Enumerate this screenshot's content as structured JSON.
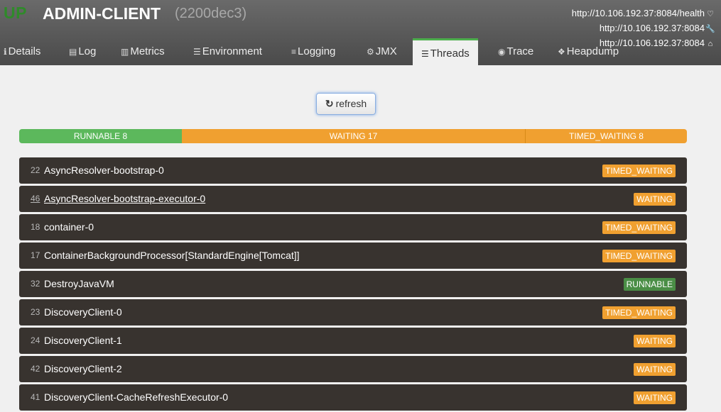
{
  "header": {
    "status": "UP",
    "app_name": "ADMIN-CLIENT",
    "app_version": "(2200dec3)",
    "urls": [
      {
        "text": "http://10.106.192.37:8084/health",
        "icon": "heartbeat-icon"
      },
      {
        "text": "http://10.106.192.37:8084",
        "icon": "wrench-icon"
      },
      {
        "text": "http://10.106.192.37:8084",
        "icon": "home-icon"
      }
    ]
  },
  "tabs": [
    {
      "label": "Details",
      "icon": "info-icon"
    },
    {
      "label": "Log",
      "icon": "file-icon"
    },
    {
      "label": "Metrics",
      "icon": "bar-chart-icon"
    },
    {
      "label": "Environment",
      "icon": "list-icon"
    },
    {
      "label": "Logging",
      "icon": "sliders-icon"
    },
    {
      "label": "JMX",
      "icon": "cogs-icon"
    },
    {
      "label": "Threads",
      "icon": "list-ul-icon",
      "active": true
    },
    {
      "label": "Trace",
      "icon": "eye-icon"
    },
    {
      "label": "Heapdump",
      "icon": "cubes-icon"
    }
  ],
  "refresh_label": "refresh",
  "summary": [
    {
      "label": "RUNNABLE 8",
      "state": "runnable",
      "count": 8
    },
    {
      "label": "WAITING 17",
      "state": "waiting",
      "count": 17
    },
    {
      "label": "TIMED_WAITING 8",
      "state": "timed",
      "count": 8
    }
  ],
  "threads": [
    {
      "id": "22",
      "name": "AsyncResolver-bootstrap-0",
      "state": "TIMED_WAITING"
    },
    {
      "id": "46",
      "name": "AsyncResolver-bootstrap-executor-0",
      "state": "WAITING"
    },
    {
      "id": "18",
      "name": "container-0",
      "state": "TIMED_WAITING"
    },
    {
      "id": "17",
      "name": "ContainerBackgroundProcessor[StandardEngine[Tomcat]]",
      "state": "TIMED_WAITING"
    },
    {
      "id": "32",
      "name": "DestroyJavaVM",
      "state": "RUNNABLE"
    },
    {
      "id": "23",
      "name": "DiscoveryClient-0",
      "state": "TIMED_WAITING"
    },
    {
      "id": "24",
      "name": "DiscoveryClient-1",
      "state": "WAITING"
    },
    {
      "id": "42",
      "name": "DiscoveryClient-2",
      "state": "WAITING"
    },
    {
      "id": "41",
      "name": "DiscoveryClient-CacheRefreshExecutor-0",
      "state": "WAITING"
    }
  ],
  "colors": {
    "status_up": "#2f8a2a",
    "runnable": "#5cb85c",
    "waiting": "#f0a030",
    "active_tab_border": "#4cae4c"
  }
}
